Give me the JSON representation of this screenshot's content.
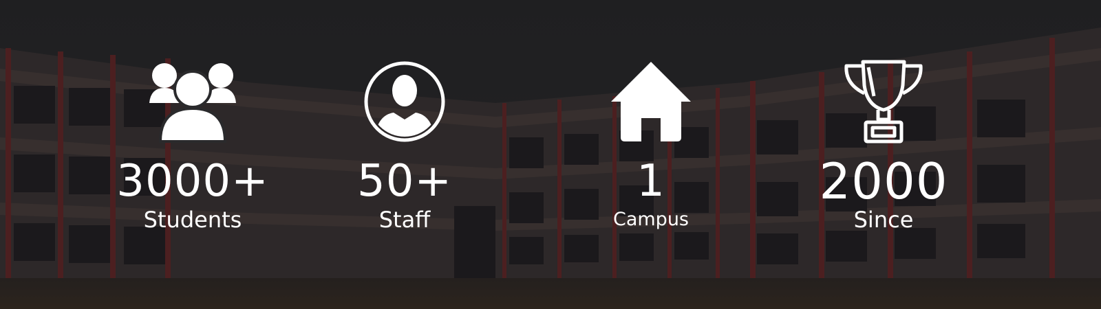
{
  "stats": [
    {
      "icon": "group-icon",
      "value": "3000+",
      "label": "Students"
    },
    {
      "icon": "user-avatar-icon",
      "value": "50+",
      "label": "Staff"
    },
    {
      "icon": "home-icon",
      "value": "1",
      "label": "Campus"
    },
    {
      "icon": "trophy-icon",
      "value": "2000",
      "label": "Since"
    }
  ],
  "colors": {
    "overlay": "#1b1b1f",
    "building_wall": "#4a3f3d",
    "building_accent": "#6e2a2a",
    "text": "#ffffff"
  }
}
